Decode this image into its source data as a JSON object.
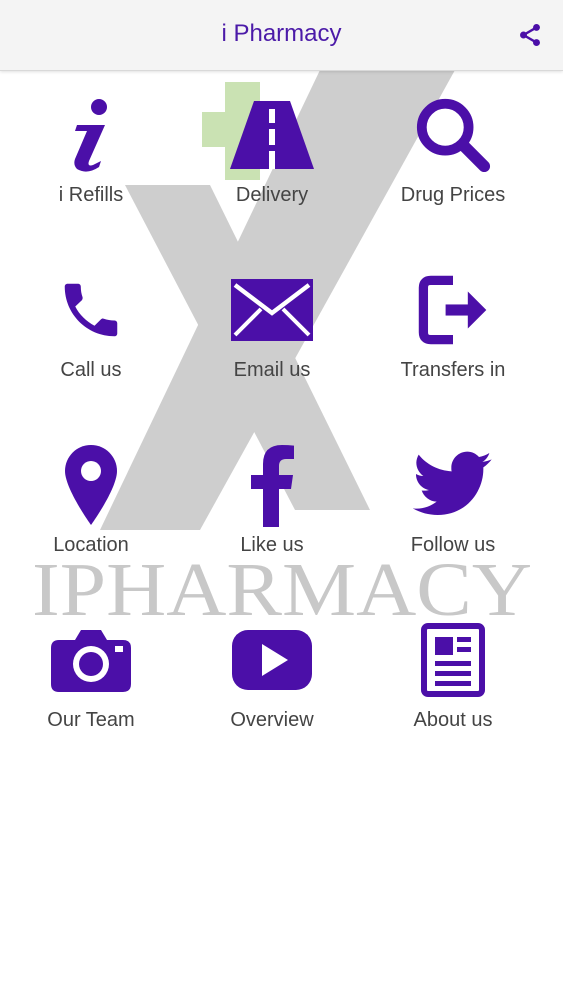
{
  "header": {
    "title": "i Pharmacy",
    "share_icon": "share-icon"
  },
  "colors": {
    "accent": "#4b0fa8",
    "header_bg": "#f4f4f4",
    "label_text": "#444444",
    "watermark_grey": "#c8c8c8",
    "watermark_green": "#b9d99a"
  },
  "watermark": {
    "text": "IPHARMACY"
  },
  "tiles": [
    {
      "label": "i Refills",
      "icon": "info-icon"
    },
    {
      "label": "Delivery",
      "icon": "road-icon"
    },
    {
      "label": "Drug Prices",
      "icon": "search-icon"
    },
    {
      "label": "Call us",
      "icon": "phone-icon"
    },
    {
      "label": "Email us",
      "icon": "envelope-icon"
    },
    {
      "label": "Transfers in",
      "icon": "sign-out-icon"
    },
    {
      "label": "Location",
      "icon": "map-pin-icon"
    },
    {
      "label": "Like us",
      "icon": "facebook-icon"
    },
    {
      "label": "Follow us",
      "icon": "twitter-icon"
    },
    {
      "label": "Our Team",
      "icon": "camera-icon"
    },
    {
      "label": "Overview",
      "icon": "play-icon"
    },
    {
      "label": "About us",
      "icon": "newspaper-icon"
    }
  ]
}
